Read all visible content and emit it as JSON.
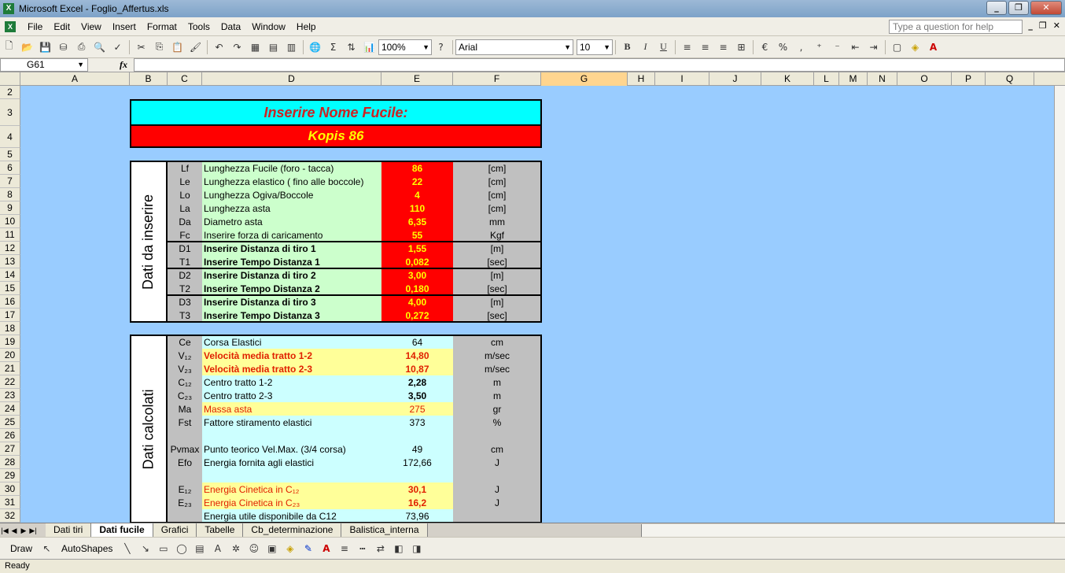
{
  "app": {
    "title": "Microsoft Excel - Foglio_Affertus.xls",
    "window_buttons": [
      "_",
      "❐",
      "✕"
    ]
  },
  "menu": {
    "items": [
      "File",
      "Edit",
      "View",
      "Insert",
      "Format",
      "Tools",
      "Data",
      "Window",
      "Help"
    ],
    "help_placeholder": "Type a question for help",
    "mdi_buttons": [
      "_",
      "❐",
      "✕"
    ]
  },
  "toolbar": {
    "zoom": "100%",
    "font_name": "Arial",
    "font_size": "10"
  },
  "formula_bar": {
    "cell_ref": "G61",
    "fx": "fx",
    "content": ""
  },
  "columns": [
    "A",
    "B",
    "C",
    "D",
    "E",
    "F",
    "G",
    "H",
    "I",
    "J",
    "K",
    "L",
    "M",
    "N",
    "O",
    "P",
    "Q"
  ],
  "rows": [
    "2",
    "3",
    "4",
    "5",
    "6",
    "7",
    "8",
    "9",
    "10",
    "11",
    "12",
    "13",
    "14",
    "15",
    "16",
    "17",
    "18",
    "19",
    "20",
    "21",
    "22",
    "23",
    "24",
    "25",
    "26",
    "27",
    "28",
    "29",
    "30",
    "31",
    "32"
  ],
  "sheet": {
    "banner_title": "Inserire Nome Fucile:",
    "banner_value": "Kopis 86",
    "input_section_label": "Dati da inserire",
    "calc_section_label": "Dati calcolati",
    "input_rows": [
      {
        "code": "Lf",
        "label": "Lunghezza Fucile (foro - tacca)",
        "value": "86",
        "unit": "[cm]"
      },
      {
        "code": "Le",
        "label": "Lunghezza elastico ( fino alle boccole)",
        "value": "22",
        "unit": "[cm]"
      },
      {
        "code": "Lo",
        "label": "Lunghezza Ogiva/Boccole",
        "value": "4",
        "unit": "[cm]"
      },
      {
        "code": "La",
        "label": "Lunghezza asta",
        "value": "110",
        "unit": "[cm]"
      },
      {
        "code": "Da",
        "label": "Diametro asta",
        "value": "6,35",
        "unit": "mm"
      },
      {
        "code": "Fc",
        "label": "Inserire forza di caricamento",
        "value": "55",
        "unit": "Kgf"
      },
      {
        "code": "D1",
        "label": "Inserire Distanza di tiro 1",
        "value": "1,55",
        "unit": "[m]"
      },
      {
        "code": "T1",
        "label": "Inserire Tempo Distanza 1",
        "value": "0,082",
        "unit": "[sec]"
      },
      {
        "code": "D2",
        "label": "Inserire Distanza di tiro 2",
        "value": "3,00",
        "unit": "[m]"
      },
      {
        "code": "T2",
        "label": "Inserire Tempo Distanza 2",
        "value": "0,180",
        "unit": "[sec]"
      },
      {
        "code": "D3",
        "label": "Inserire Distanza di tiro 3",
        "value": "4,00",
        "unit": "[m]"
      },
      {
        "code": "T3",
        "label": "Inserire Tempo Distanza 3",
        "value": "0,272",
        "unit": "[sec]"
      }
    ],
    "calc_rows": [
      {
        "code": "Ce",
        "label": "Corsa Elastici",
        "value": "64",
        "unit": "cm"
      },
      {
        "code": "V₁₂",
        "label": "Velocità media tratto 1-2",
        "value": "14,80",
        "unit": "m/sec"
      },
      {
        "code": "V₂₃",
        "label": "Velocità media tratto 2-3",
        "value": "10,87",
        "unit": "m/sec"
      },
      {
        "code": "C₁₂",
        "label": "Centro tratto 1-2",
        "value": "2,28",
        "unit": "m"
      },
      {
        "code": "C₂₃",
        "label": "Centro tratto 2-3",
        "value": "3,50",
        "unit": "m"
      },
      {
        "code": "Ma",
        "label": "Massa asta",
        "value": "275",
        "unit": "gr"
      },
      {
        "code": "Fst",
        "label": "Fattore stiramento elastici",
        "value": "373",
        "unit": "%"
      },
      {
        "code": "",
        "label": "",
        "value": "",
        "unit": ""
      },
      {
        "code": "Pvmax",
        "label": "Punto teorico Vel.Max. (3/4 corsa)",
        "value": "49",
        "unit": "cm"
      },
      {
        "code": "Efo",
        "label": "Energia fornita agli elastici",
        "value": "172,66",
        "unit": "J"
      },
      {
        "code": "",
        "label": "",
        "value": "",
        "unit": ""
      },
      {
        "code": "E₁₂",
        "label": "Energia Cinetica in  C₁₂",
        "value": "30,1",
        "unit": "J"
      },
      {
        "code": "E₂₃",
        "label": "Energia Cinetica in  C₂₃",
        "value": "16,2",
        "unit": "J"
      },
      {
        "code": "",
        "label": "Energia utile disponibile da C12",
        "value": "73,96",
        "unit": ""
      }
    ]
  },
  "tabs": [
    "Dati tiri",
    "Dati fucile",
    "Grafici",
    "Tabelle",
    "Cb_determinazione",
    "Balistica_interna"
  ],
  "active_tab": "Dati fucile",
  "drawing": {
    "draw_label": "Draw",
    "autoshapes_label": "AutoShapes"
  },
  "status": "Ready",
  "colors": {
    "sheet_bg": "#99ccff",
    "banner_cyan": "#00ffff",
    "banner_red": "#ff0000",
    "input_label_bg": "#ccffcc",
    "value_red": "#ff0000",
    "unit_gray": "#c0c0c0",
    "calc_bg": "#ccffff",
    "calc_highlight": "#ffff99"
  }
}
